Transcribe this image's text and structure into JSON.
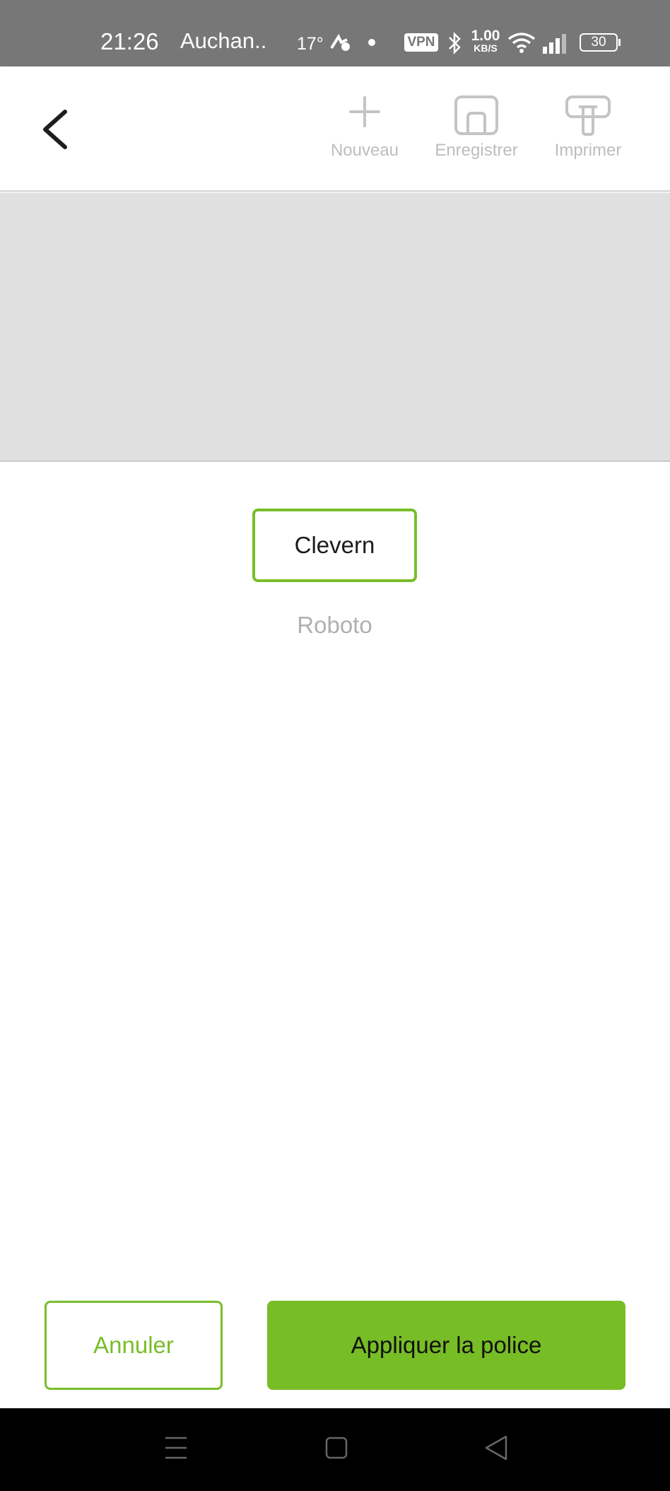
{
  "status_bar": {
    "time": "21:26",
    "carrier": "Auchan..",
    "temperature": "17°",
    "vpn": "VPN",
    "speed_value": "1.00",
    "speed_unit": "KB/S",
    "battery": "30"
  },
  "toolbar": {
    "new_label": "Nouveau",
    "save_label": "Enregistrer",
    "print_label": "Imprimer"
  },
  "fonts": {
    "selected": "Clevern",
    "other": "Roboto"
  },
  "actions": {
    "cancel_label": "Annuler",
    "apply_label": "Appliquer la police"
  },
  "colors": {
    "accent": "#77bd25",
    "status_bar": "#777777",
    "preview_bg": "#e0e0e0",
    "disabled_icon": "#bdbdbd"
  },
  "icons": [
    "back-arrow-icon",
    "plus-icon",
    "save-icon",
    "print-icon",
    "bluetooth-icon",
    "wifi-icon",
    "signal-icon",
    "battery-icon",
    "menu-icon",
    "home-icon",
    "back-triangle-icon"
  ]
}
